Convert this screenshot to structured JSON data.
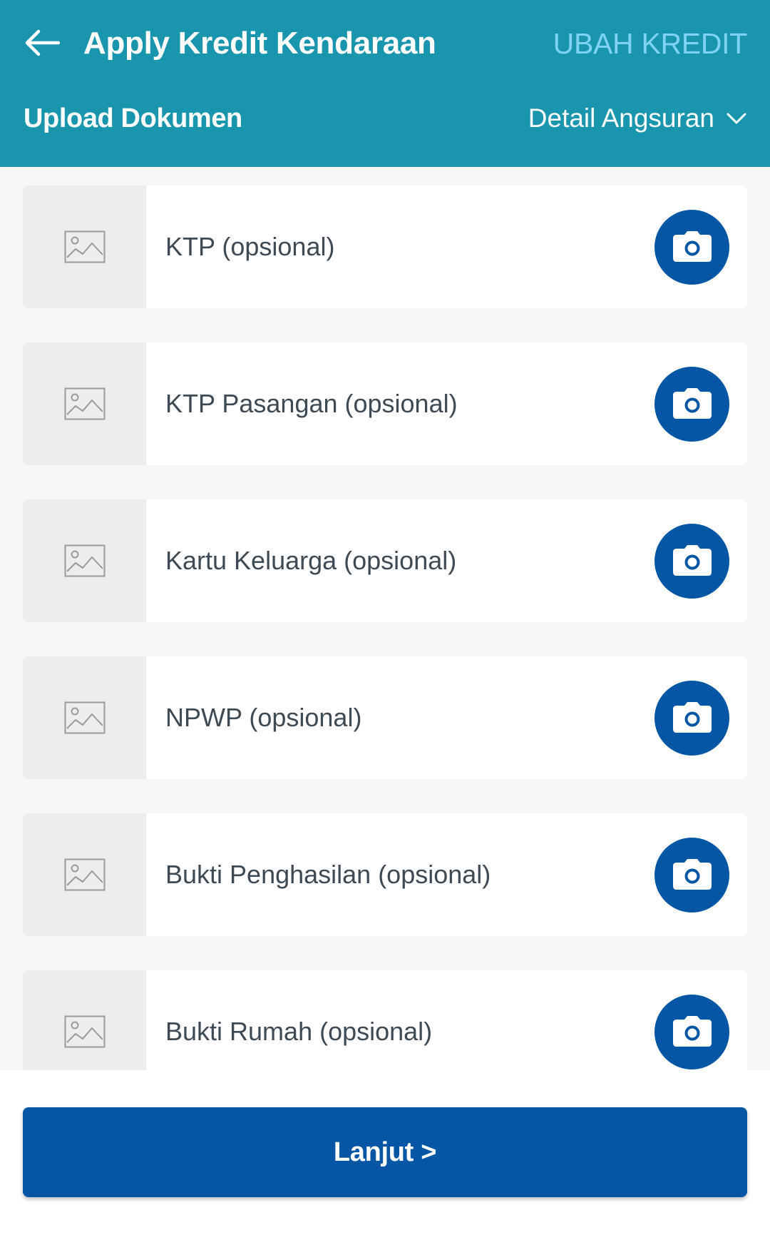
{
  "header": {
    "title": "Apply Kredit Kendaraan",
    "action_label": "UBAH KREDIT",
    "subtitle": "Upload Dokumen",
    "detail_label": "Detail Angsuran",
    "back_icon": "arrow-left-icon",
    "detail_icon": "chevron-down-icon"
  },
  "documents": [
    {
      "label": "KTP (opsional)",
      "thumb_icon": "image-placeholder-icon",
      "action_icon": "camera-icon"
    },
    {
      "label": "KTP Pasangan (opsional)",
      "thumb_icon": "image-placeholder-icon",
      "action_icon": "camera-icon"
    },
    {
      "label": "Kartu Keluarga (opsional)",
      "thumb_icon": "image-placeholder-icon",
      "action_icon": "camera-icon"
    },
    {
      "label": "NPWP (opsional)",
      "thumb_icon": "image-placeholder-icon",
      "action_icon": "camera-icon"
    },
    {
      "label": "Bukti Penghasilan (opsional)",
      "thumb_icon": "image-placeholder-icon",
      "action_icon": "camera-icon"
    },
    {
      "label": "Bukti Rumah (opsional)",
      "thumb_icon": "image-placeholder-icon",
      "action_icon": "camera-icon"
    }
  ],
  "footer": {
    "button_label": "Lanjut >"
  },
  "colors": {
    "app_bar": "#1996ae",
    "accent_link": "#7fd2f0",
    "primary": "#0557a6",
    "background": "#f7f7f7",
    "thumb_bg": "#ededed",
    "text": "#3d4a55"
  }
}
